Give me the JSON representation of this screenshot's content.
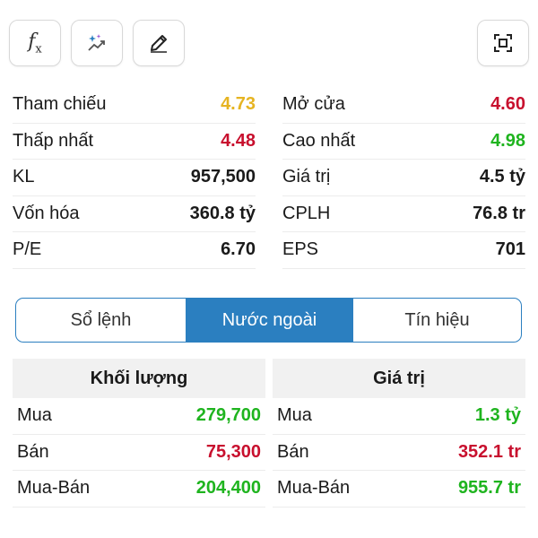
{
  "colors": {
    "reference": "#e6b422",
    "down": "#c8102e",
    "up": "#1fb41f",
    "neutral": "#1a1a1a",
    "accent": "#2b7fc0"
  },
  "toolbar": {
    "buttons": [
      {
        "icon": "formula-icon"
      },
      {
        "icon": "magic-indicator-icon"
      },
      {
        "icon": "pencil-icon"
      },
      {
        "icon": "fullscreen-icon"
      }
    ]
  },
  "stats": [
    [
      {
        "label": "Tham chiếu",
        "value": "4.73",
        "color": "#e6b422"
      },
      {
        "label": "Mở cửa",
        "value": "4.60",
        "color": "#c8102e"
      }
    ],
    [
      {
        "label": "Thấp nhất",
        "value": "4.48",
        "color": "#c8102e"
      },
      {
        "label": "Cao nhất",
        "value": "4.98",
        "color": "#1fb41f"
      }
    ],
    [
      {
        "label": "KL",
        "value": "957,500",
        "color": "#1a1a1a"
      },
      {
        "label": "Giá trị",
        "value": "4.5 tỷ",
        "color": "#1a1a1a"
      }
    ],
    [
      {
        "label": "Vốn hóa",
        "value": "360.8 tỷ",
        "color": "#1a1a1a"
      },
      {
        "label": "CPLH",
        "value": "76.8 tr",
        "color": "#1a1a1a"
      }
    ],
    [
      {
        "label": "P/E",
        "value": "6.70",
        "color": "#1a1a1a"
      },
      {
        "label": "EPS",
        "value": "701",
        "color": "#1a1a1a"
      }
    ]
  ],
  "tabs": [
    {
      "label": "Sổ lệnh",
      "active": false
    },
    {
      "label": "Nước ngoài",
      "active": true
    },
    {
      "label": "Tín hiệu",
      "active": false
    }
  ],
  "foreign": {
    "volume": {
      "header": "Khối lượng",
      "rows": [
        {
          "label": "Mua",
          "value": "279,700",
          "color": "#1fb41f"
        },
        {
          "label": "Bán",
          "value": "75,300",
          "color": "#c8102e"
        },
        {
          "label": "Mua-Bán",
          "value": "204,400",
          "color": "#1fb41f"
        }
      ]
    },
    "value": {
      "header": "Giá trị",
      "rows": [
        {
          "label": "Mua",
          "value": "1.3 tỷ",
          "color": "#1fb41f"
        },
        {
          "label": "Bán",
          "value": "352.1 tr",
          "color": "#c8102e"
        },
        {
          "label": "Mua-Bán",
          "value": "955.7 tr",
          "color": "#1fb41f"
        }
      ]
    }
  }
}
